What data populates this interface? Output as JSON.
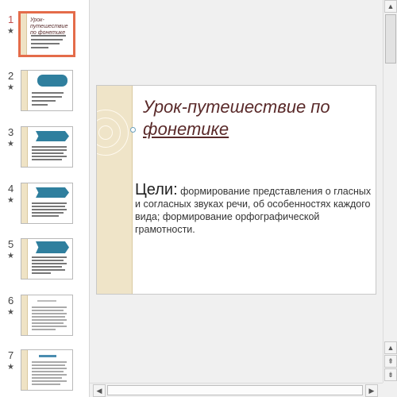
{
  "slide_panel": {
    "thumbnails": [
      {
        "number": "1",
        "star": "★",
        "title": "Урок-путешествие по фонетике"
      },
      {
        "number": "2",
        "star": "★"
      },
      {
        "number": "3",
        "star": "★"
      },
      {
        "number": "4",
        "star": "★"
      },
      {
        "number": "5",
        "star": "★"
      },
      {
        "number": "6",
        "star": "★"
      },
      {
        "number": "7",
        "star": "★"
      }
    ]
  },
  "slide": {
    "title_line1": "Урок-путешествие по",
    "title_line2": "фонетике",
    "goals_label": "Цели:",
    "goals_text": "формирование представления о гласных и согласных звуках речи, об особенностях каждого вида; формирование орфографической грамотности."
  },
  "scrollbars": {
    "up_arrow": "▲",
    "down_arrow": "▼",
    "prev_slide": "⇞",
    "next_slide": "⇟",
    "left_arrow": "◀",
    "right_arrow": "▶"
  },
  "colors": {
    "accent_selection": "#e46c4a",
    "band": "#efe4c8",
    "banner": "#2f7f9e",
    "title": "#5a2a2a"
  }
}
